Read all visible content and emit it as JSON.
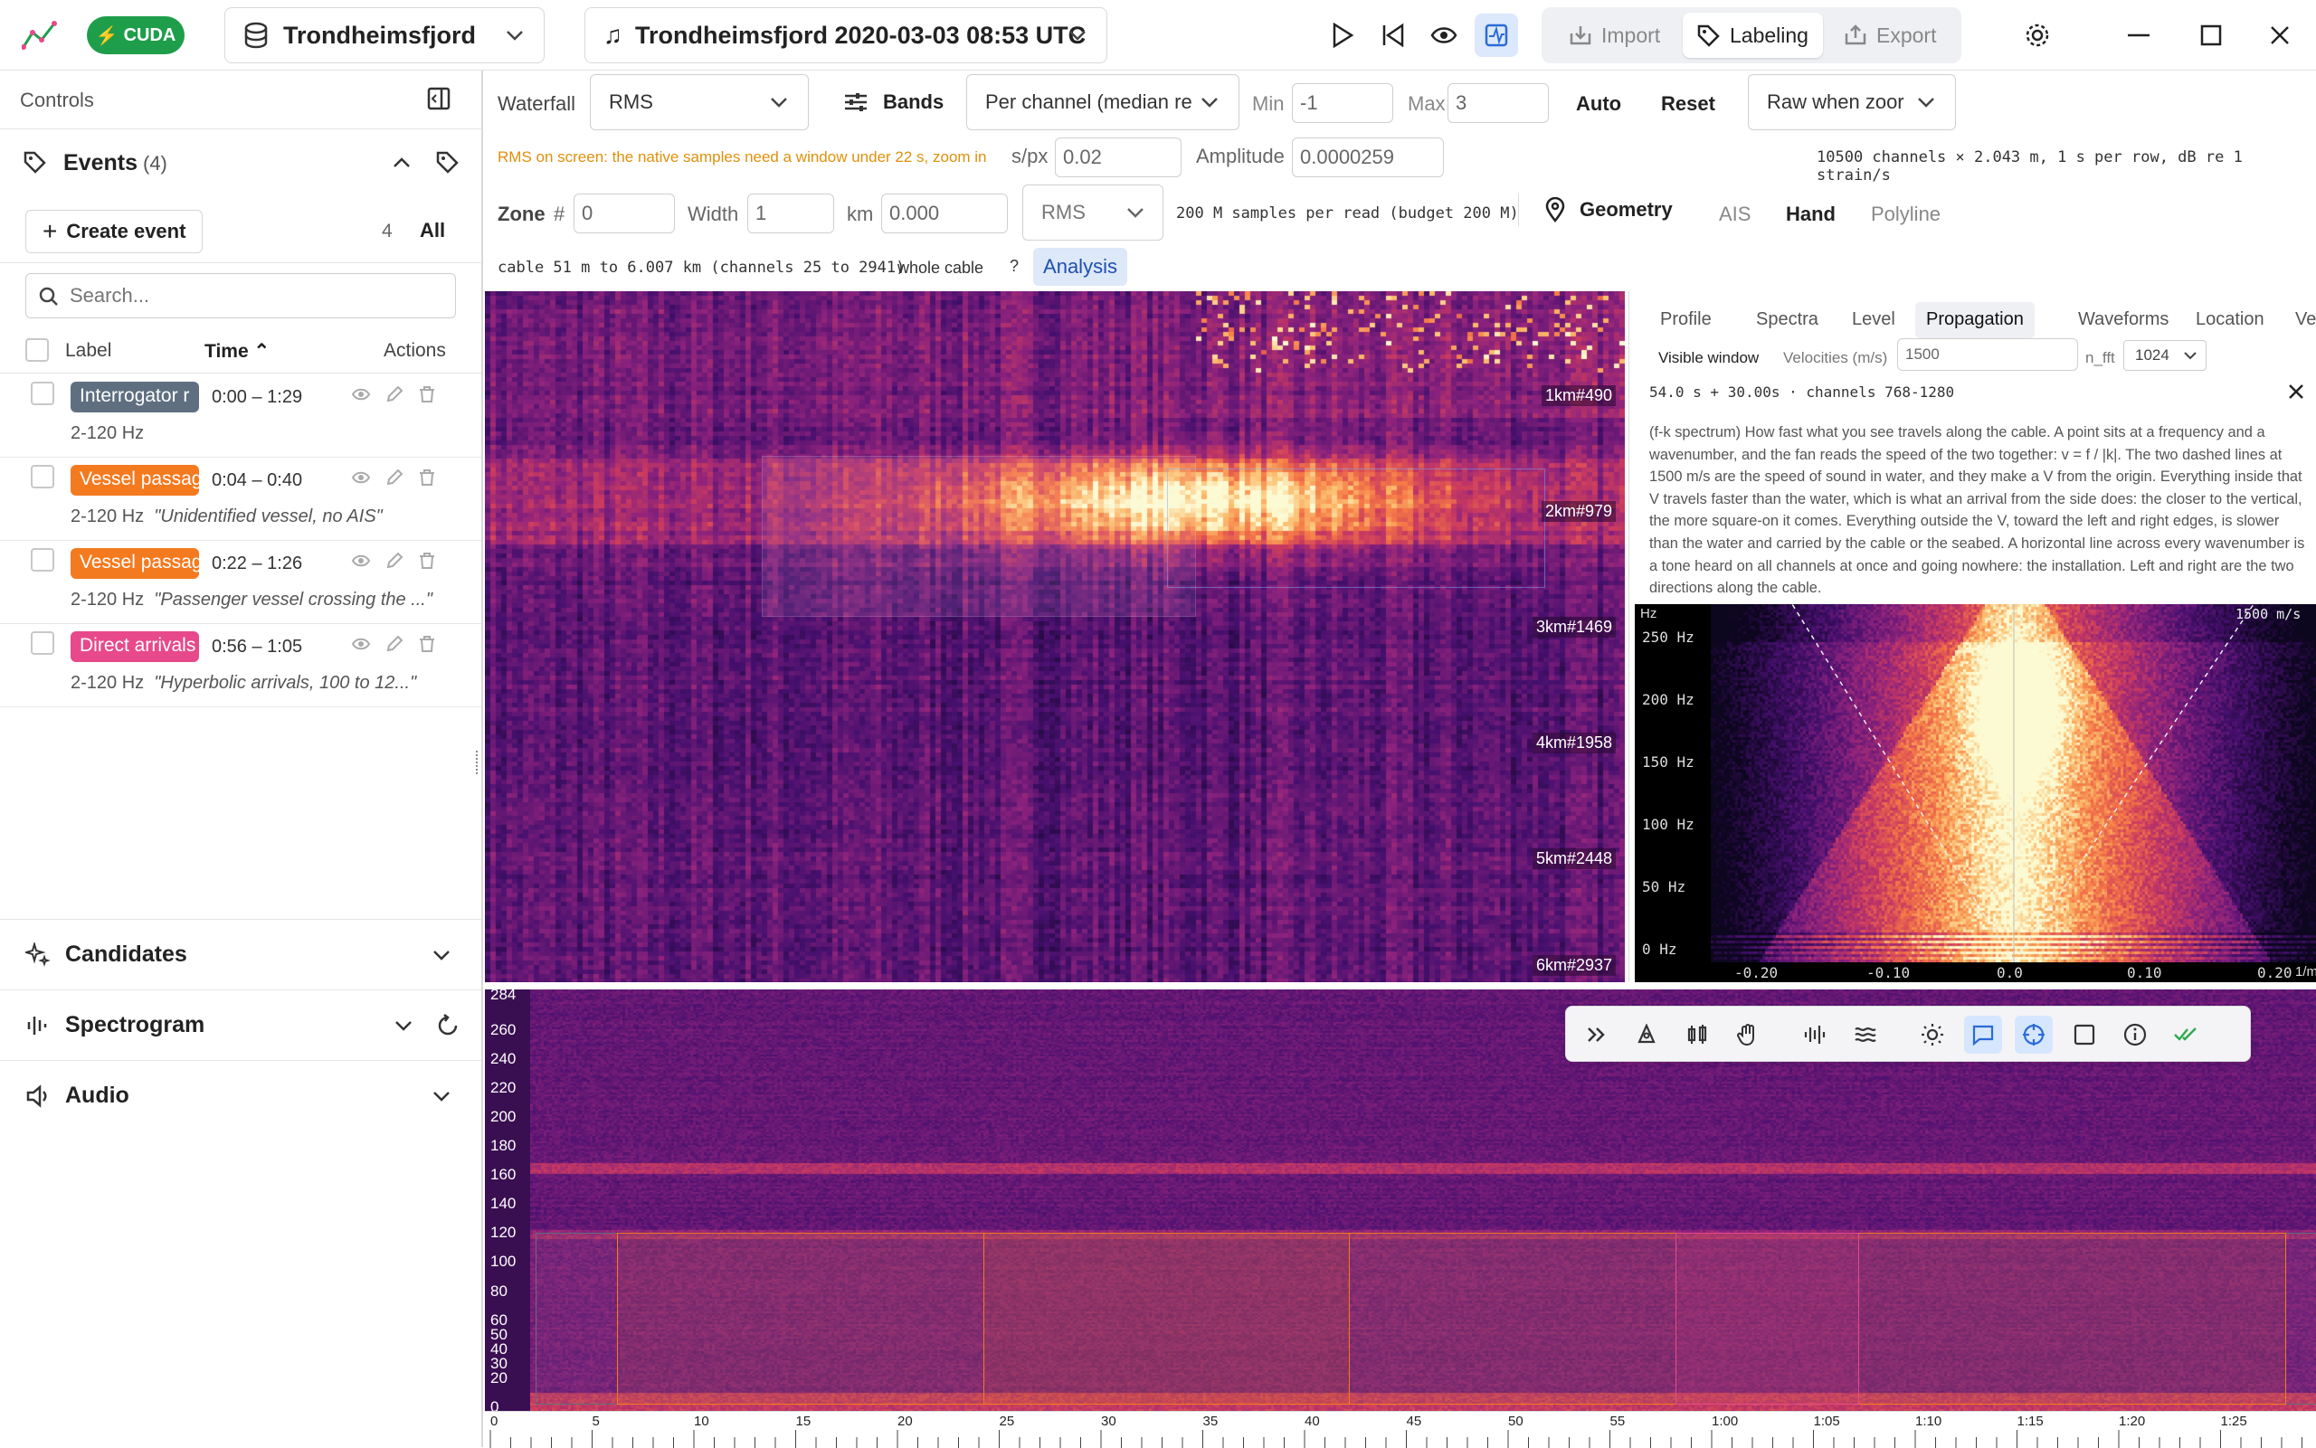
{
  "app": {
    "gpu_badge": "CUDA"
  },
  "header": {
    "dataset": "Trondheimsfjord",
    "recording": "Trondheimsfjord 2020-03-03 08:53 UTC",
    "modes": [
      "Import",
      "Labeling",
      "Export"
    ],
    "active_mode": "Labeling"
  },
  "sidebar": {
    "title": "Controls",
    "events_label": "Events",
    "events_count": "(4)",
    "create_event": "Create event",
    "filter_count": "4",
    "filter_all": "All",
    "search_placeholder": "Search...",
    "columns": {
      "label": "Label",
      "time": "Time",
      "actions": "Actions"
    },
    "events": [
      {
        "label": "Interrogator r",
        "color": "#5f6f80",
        "time": "0:00 – 1:29",
        "band": "2-120 Hz",
        "note": ""
      },
      {
        "label": "Vessel passag",
        "color": "#f47a1f",
        "time": "0:04 – 0:40",
        "band": "2-120 Hz",
        "note": "\"Unidentified vessel, no AIS\""
      },
      {
        "label": "Vessel passag",
        "color": "#f47a1f",
        "time": "0:22 – 1:26",
        "band": "2-120 Hz",
        "note": "\"Passenger vessel crossing the ...\""
      },
      {
        "label": "Direct arrivals",
        "color": "#e8498a",
        "time": "0:56 – 1:05",
        "band": "2-120 Hz",
        "note": "\"Hyperbolic arrivals, 100 to 12...\""
      }
    ],
    "sections": [
      "Candidates",
      "Spectrogram",
      "Audio"
    ]
  },
  "toolbar": {
    "waterfall_label": "Waterfall",
    "waterfall_mode": "RMS",
    "bands": "Bands",
    "normalize": "Per channel (median re",
    "min_label": "Min",
    "min_value": "-1",
    "max_label": "Max",
    "max_value": "3",
    "auto": "Auto",
    "reset": "Reset",
    "raw_mode": "Raw when zoor",
    "rms_warning": "RMS on screen: the native samples need a window under 22 s, zoom in",
    "spx_label": "s/px",
    "spx_value": "0.02",
    "amp_label": "Amplitude",
    "amp_value": "0.0000259",
    "channels_info": "10500 channels × 2.043 m, 1 s per row, dB re 1 strain/s",
    "zone_label": "Zone",
    "zone_hash": "#",
    "zone_value": "0",
    "width_label": "Width",
    "width_value": "1",
    "km_label": "km",
    "km_value": "0.000",
    "zone_mode": "RMS",
    "samples_info": "200 M samples per read (budget 200 M)",
    "geometry": "Geometry",
    "ais": "AIS",
    "hand": "Hand",
    "polyline": "Polyline",
    "cable_info": "cable 51 m to 6.007 km (channels 25 to 2941)",
    "whole_cable": "whole cable",
    "help": "?",
    "analysis": "Analysis"
  },
  "waterfall": {
    "distance_labels": [
      "1km#490",
      "2km#979",
      "3km#1469",
      "4km#1958",
      "5km#2448",
      "6km#2937"
    ]
  },
  "panel": {
    "tabs": [
      "Profile",
      "Spectra",
      "Level",
      "Propagation",
      "Waveforms",
      "Location",
      "Vessel"
    ],
    "active_tab": "Propagation",
    "visible_window": "Visible window",
    "velocities_label": "Velocities (m/s)",
    "velocities_value": "1500",
    "nfft_label": "n_fft",
    "nfft_value": "1024",
    "window_info": "54.0 s + 30.00s · channels 768-1280",
    "description": "(f-k spectrum) How fast what you see travels along the cable. A point sits at a frequency and a wavenumber, and the fan reads the speed of the two together: v = f / |k|. The two dashed lines at 1500 m/s are the speed of sound in water, and they make a V from the origin. Everything inside that V travels faster than the water, which is what an arrival from the side does: the closer to the vertical, the more square-on it comes. Everything outside the V, toward the left and right edges, is slower than the water and carried by the cable or the seabed. A horizontal line across every wavenumber is a tone heard on all channels at once and going nowhere: the installation. Left and right are the two directions along the cable.",
    "fk_y_unit": "Hz",
    "fk_y_ticks": [
      "250 Hz",
      "200 Hz",
      "150 Hz",
      "100 Hz",
      "50 Hz",
      "0 Hz"
    ],
    "fk_x_ticks": [
      "-0.20",
      "-0.10",
      "0.0",
      "0.10",
      "0.20"
    ],
    "fk_x_unit": "1/m",
    "fk_line_label": "1500 m/s"
  },
  "spectrogram": {
    "y_ticks": [
      "284",
      "260",
      "240",
      "220",
      "200",
      "180",
      "160",
      "140",
      "120",
      "100",
      "80",
      "60",
      "50",
      "40",
      "30",
      "20",
      "0"
    ],
    "x_ticks": [
      "0",
      "5",
      "10",
      "15",
      "20",
      "25",
      "30",
      "35",
      "40",
      "45",
      "50",
      "55",
      "1:00",
      "1:05",
      "1:10",
      "1:15",
      "1:20",
      "1:25"
    ]
  }
}
